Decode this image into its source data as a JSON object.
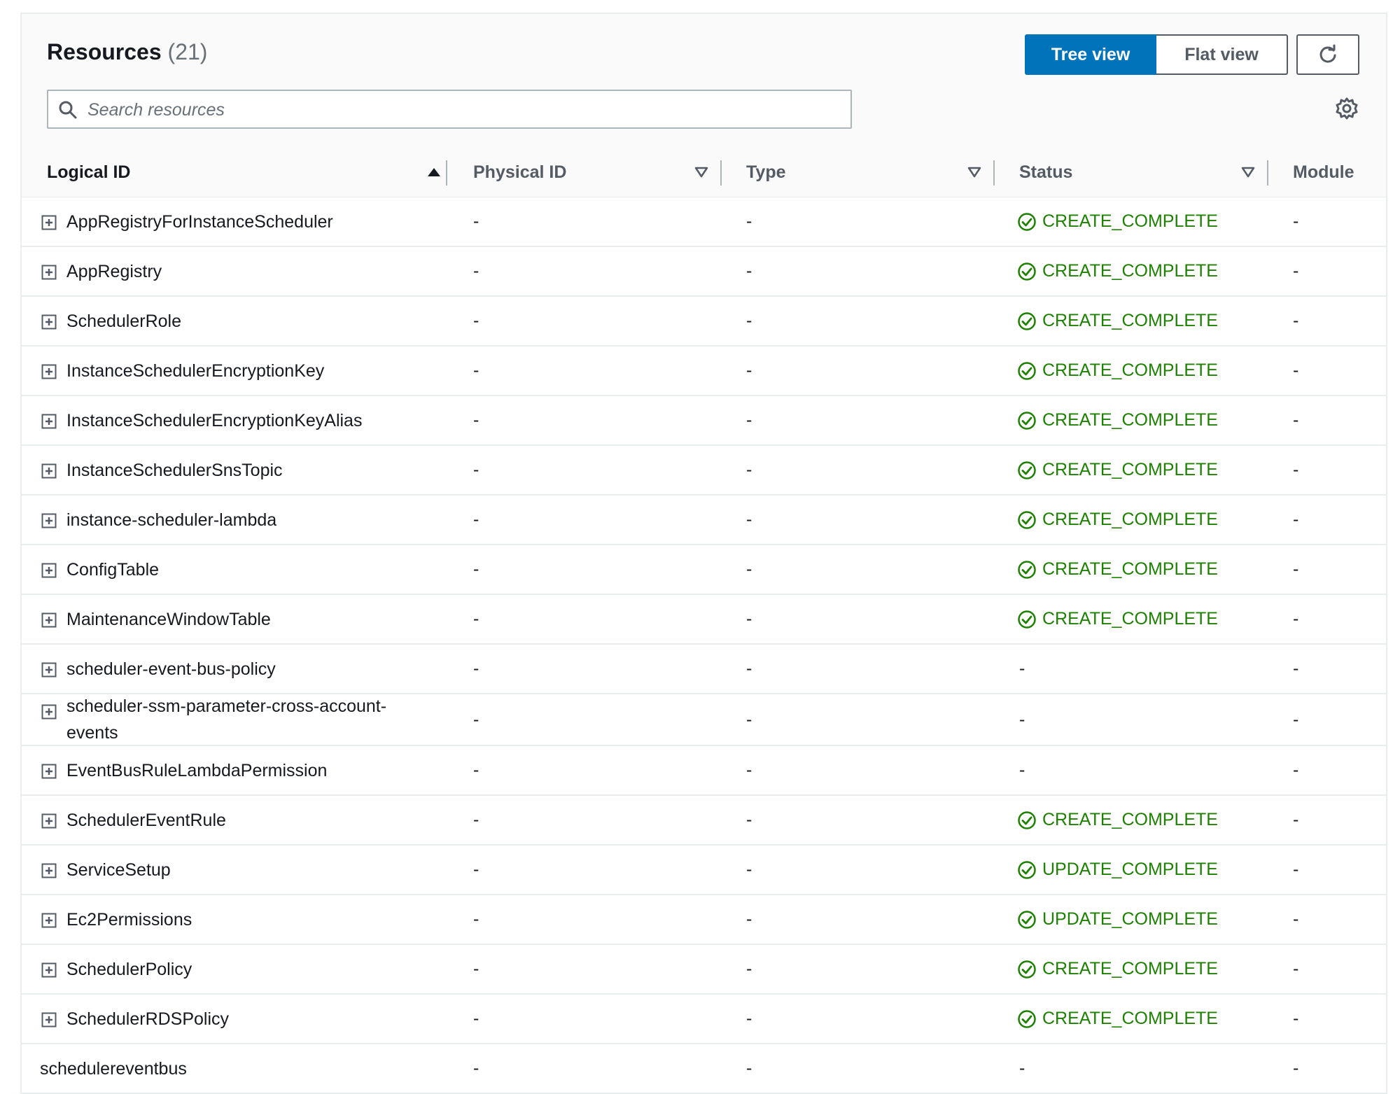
{
  "header": {
    "title": "Resources",
    "count": "(21)",
    "tree_view_label": "Tree view",
    "flat_view_label": "Flat view",
    "search_placeholder": "Search resources"
  },
  "columns": {
    "logical_id": "Logical ID",
    "physical_id": "Physical ID",
    "type": "Type",
    "status": "Status",
    "module": "Module"
  },
  "colors": {
    "accent": "#0073bb",
    "success": "#1d8102"
  },
  "icons": {
    "search": "search-icon",
    "refresh": "refresh-icon",
    "settings": "gear-icon",
    "expand": "expand-plus-icon",
    "sort_asc": "caret-up-icon",
    "sort_desc": "caret-down-icon",
    "status_ok": "check-circle-icon"
  },
  "rows": [
    {
      "logical_id": "AppRegistryForInstanceScheduler",
      "physical_id": "-",
      "type": "-",
      "status": "CREATE_COMPLETE",
      "module": "-",
      "expandable": true
    },
    {
      "logical_id": "AppRegistry",
      "physical_id": "-",
      "type": "-",
      "status": "CREATE_COMPLETE",
      "module": "-",
      "expandable": true
    },
    {
      "logical_id": "SchedulerRole",
      "physical_id": "-",
      "type": "-",
      "status": "CREATE_COMPLETE",
      "module": "-",
      "expandable": true
    },
    {
      "logical_id": "InstanceSchedulerEncryptionKey",
      "physical_id": "-",
      "type": "-",
      "status": "CREATE_COMPLETE",
      "module": "-",
      "expandable": true
    },
    {
      "logical_id": "InstanceSchedulerEncryptionKeyAlias",
      "physical_id": "-",
      "type": "-",
      "status": "CREATE_COMPLETE",
      "module": "-",
      "expandable": true
    },
    {
      "logical_id": "InstanceSchedulerSnsTopic",
      "physical_id": "-",
      "type": "-",
      "status": "CREATE_COMPLETE",
      "module": "-",
      "expandable": true
    },
    {
      "logical_id": "instance-scheduler-lambda",
      "physical_id": "-",
      "type": "-",
      "status": "CREATE_COMPLETE",
      "module": "-",
      "expandable": true
    },
    {
      "logical_id": "ConfigTable",
      "physical_id": "-",
      "type": "-",
      "status": "CREATE_COMPLETE",
      "module": "-",
      "expandable": true
    },
    {
      "logical_id": "MaintenanceWindowTable",
      "physical_id": "-",
      "type": "-",
      "status": "CREATE_COMPLETE",
      "module": "-",
      "expandable": true
    },
    {
      "logical_id": "scheduler-event-bus-policy",
      "physical_id": "-",
      "type": "-",
      "status": "-",
      "module": "-",
      "expandable": true
    },
    {
      "logical_id": "scheduler-ssm-parameter-cross-account-events",
      "logical_id_line1": "scheduler-ssm-parameter-cross-account-",
      "logical_id_line2": "events",
      "physical_id": "-",
      "type": "-",
      "status": "-",
      "module": "-",
      "expandable": true
    },
    {
      "logical_id": "EventBusRuleLambdaPermission",
      "physical_id": "-",
      "type": "-",
      "status": "-",
      "module": "-",
      "expandable": true
    },
    {
      "logical_id": "SchedulerEventRule",
      "physical_id": "-",
      "type": "-",
      "status": "CREATE_COMPLETE",
      "module": "-",
      "expandable": true
    },
    {
      "logical_id": "ServiceSetup",
      "physical_id": "-",
      "type": "-",
      "status": "UPDATE_COMPLETE",
      "module": "-",
      "expandable": true
    },
    {
      "logical_id": "Ec2Permissions",
      "physical_id": "-",
      "type": "-",
      "status": "UPDATE_COMPLETE",
      "module": "-",
      "expandable": true
    },
    {
      "logical_id": "SchedulerPolicy",
      "physical_id": "-",
      "type": "-",
      "status": "CREATE_COMPLETE",
      "module": "-",
      "expandable": true
    },
    {
      "logical_id": "SchedulerRDSPolicy",
      "physical_id": "-",
      "type": "-",
      "status": "CREATE_COMPLETE",
      "module": "-",
      "expandable": true
    },
    {
      "logical_id": "schedulereventbus",
      "physical_id": "-",
      "type": "-",
      "status": "-",
      "module": "-",
      "expandable": false
    }
  ]
}
